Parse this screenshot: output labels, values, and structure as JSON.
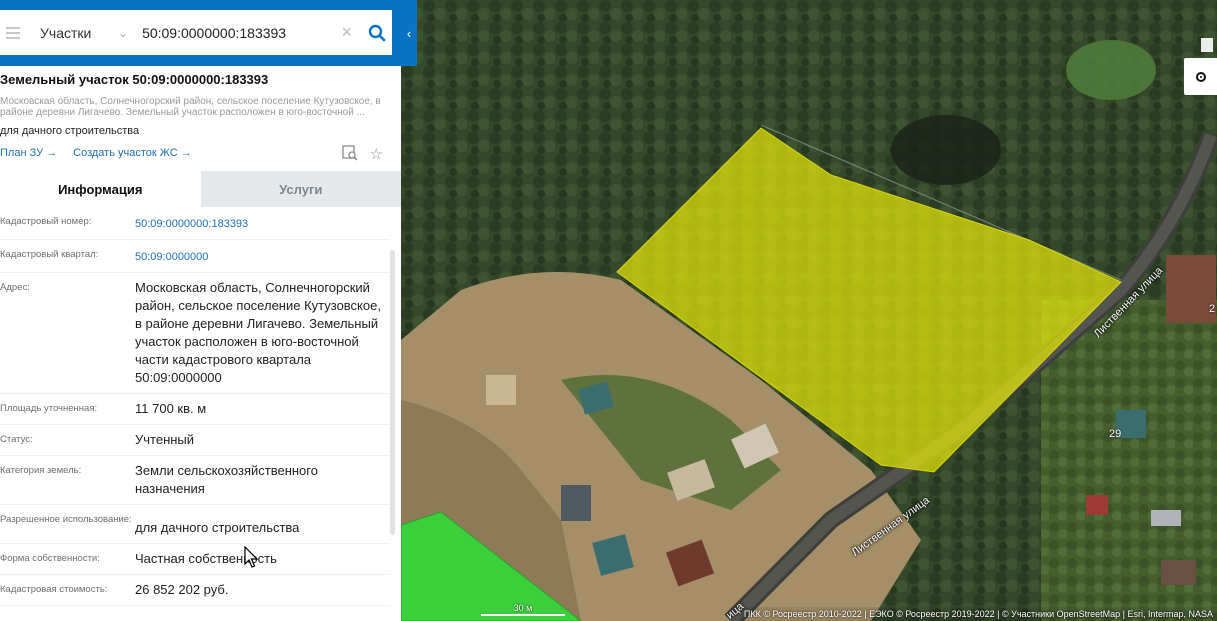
{
  "search": {
    "category": "Участки",
    "query": "50:09:0000000:183393"
  },
  "parcel": {
    "title": "Земельный участок 50:09:0000000:183393",
    "address_short": "Московская область, Солнечногорский район, сельское поселение Кутузовское, в районе деревни Лигачево. Земельный участок расположен в юго-восточной ...",
    "purpose": "для дачного строительства",
    "link_plan": "План ЗУ →",
    "link_create": "Создать участок ЖС →"
  },
  "tabs": {
    "info": "Информация",
    "services": "Услуги"
  },
  "details": [
    {
      "label": "Кадастровый номер:",
      "value": "50:09:0000000:183393",
      "link": true
    },
    {
      "label": "Кадастровый квартал:",
      "value": "50:09:0000000",
      "link": true
    },
    {
      "label": "Адрес:",
      "value": "Московская область, Солнечногорский район, сельское поселение Кутузовское, в районе деревни Лигачево. Земельный участок расположен в юго-восточной части кадастрового квартала 50:09:0000000",
      "link": false
    },
    {
      "label": "Площадь уточненная:",
      "value": "11 700 кв. м",
      "link": false
    },
    {
      "label": "Статус:",
      "value": "Учтенный",
      "link": false
    },
    {
      "label": "Категория земель:",
      "value": "Земли сельскохозяйственного назначения",
      "link": false
    },
    {
      "label": "Разрешенное использование:",
      "value": "для дачного строительства",
      "link": false
    },
    {
      "label": "Форма собственности:",
      "value": "Частная собственность",
      "link": false
    },
    {
      "label": "Кадастровая стоимость:",
      "value": "26 852 202 руб.",
      "link": false
    }
  ],
  "map": {
    "street_1": "Лиственная улица",
    "street_2": "Лиственная улица",
    "street_3": "ица",
    "house_29": "29",
    "house_2": "2",
    "scale": "30 м",
    "attribution": "ПКК © Росреестр 2010-2022 | ЕЭКО © Росреестр 2019-2022 | © Участники OpenStreetMap | Esri, Intermap, NASA",
    "parcel_color": "#e6e60a",
    "zone_color": "#3ccf3c"
  },
  "icons": [
    "hamburger-icon",
    "chevron-down-icon",
    "close-icon",
    "search-icon",
    "chevron-left-icon",
    "print-preview-icon",
    "star-icon",
    "locate-icon",
    "cursor-icon"
  ]
}
